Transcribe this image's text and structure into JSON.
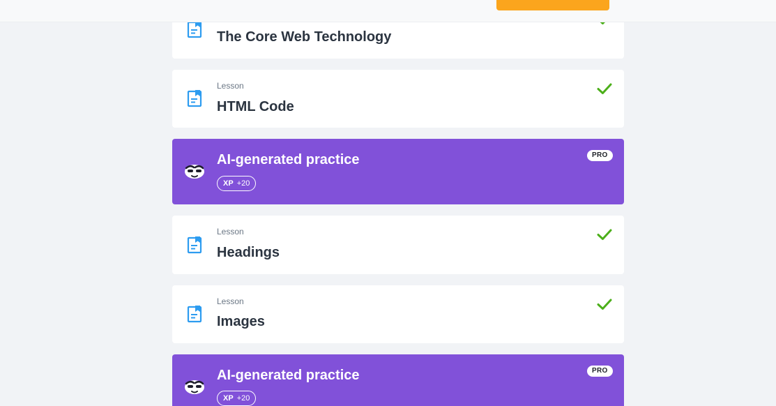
{
  "header": {
    "action_button_label": ""
  },
  "items": [
    {
      "kind": "lesson",
      "subtitle": "",
      "title": "The Core Web Technology",
      "completed": true,
      "icon": "lesson-document-icon"
    },
    {
      "kind": "lesson",
      "subtitle": "Lesson",
      "title": "HTML Code",
      "completed": true,
      "icon": "lesson-document-icon"
    },
    {
      "kind": "practice",
      "title": "AI-generated practice",
      "badge": "PRO",
      "xp_label": "XP",
      "xp_value": "+20",
      "icon": "mascot-icon"
    },
    {
      "kind": "lesson",
      "subtitle": "Lesson",
      "title": "Headings",
      "completed": true,
      "icon": "lesson-document-icon"
    },
    {
      "kind": "lesson",
      "subtitle": "Lesson",
      "title": "Images",
      "completed": true,
      "icon": "lesson-document-icon"
    },
    {
      "kind": "practice",
      "title": "AI-generated practice",
      "badge": "PRO",
      "xp_label": "XP",
      "xp_value": "+20",
      "icon": "mascot-icon"
    }
  ],
  "colors": {
    "accent_purple": "#8151d9",
    "check_green": "#4caf1a",
    "icon_blue": "#2d9cf0",
    "header_button": "#fba51d"
  }
}
